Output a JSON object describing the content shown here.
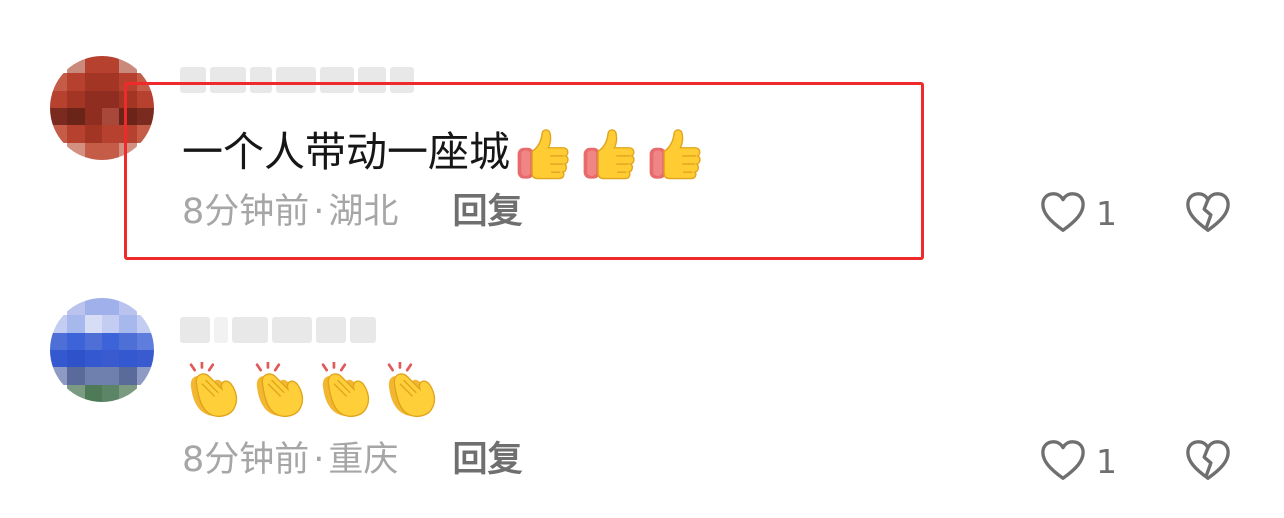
{
  "comments": [
    {
      "text": "一个人带动一座城",
      "emoji": [
        "thumbs-up",
        "thumbs-up",
        "thumbs-up"
      ],
      "time": "8分钟前",
      "separator": "·",
      "location": "湖北",
      "reply_label": "回复",
      "like_count": "1",
      "avatar_color": "#b5412e",
      "highlighted": true
    },
    {
      "text": "",
      "emoji": [
        "clapping-hands",
        "clapping-hands",
        "clapping-hands",
        "clapping-hands"
      ],
      "time": "8分钟前",
      "separator": "·",
      "location": "重庆",
      "reply_label": "回复",
      "like_count": "1",
      "avatar_color": "#4d6fd6",
      "highlighted": false
    }
  ],
  "colors": {
    "highlight_border": "#ee2a2a",
    "meta_text": "#a6a6a6",
    "action_text": "#6f6f6f",
    "comment_text": "#161616"
  },
  "icons": {
    "like": "heart-outline-icon",
    "dislike": "broken-heart-outline-icon"
  }
}
